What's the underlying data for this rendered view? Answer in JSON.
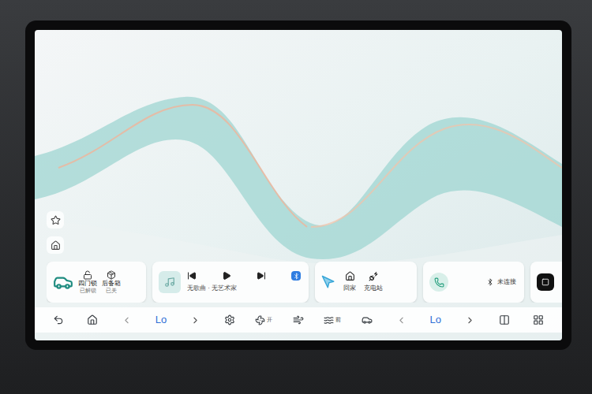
{
  "vehicle_card": {
    "items": [
      {
        "label": "四门锁",
        "status": "已解锁"
      },
      {
        "label": "后备箱",
        "status": "已关"
      }
    ]
  },
  "media_card": {
    "track": "无歌曲 · 无艺术家",
    "playing": false,
    "bluetooth": true
  },
  "nav_card": {
    "shortcuts": [
      {
        "label": "回家"
      },
      {
        "label": "充电站"
      }
    ]
  },
  "phone_card": {
    "status": "未连接"
  },
  "climate_bar": {
    "left_temp": "Lo",
    "fan": "开",
    "defrost": "前",
    "right_temp": "Lo"
  }
}
